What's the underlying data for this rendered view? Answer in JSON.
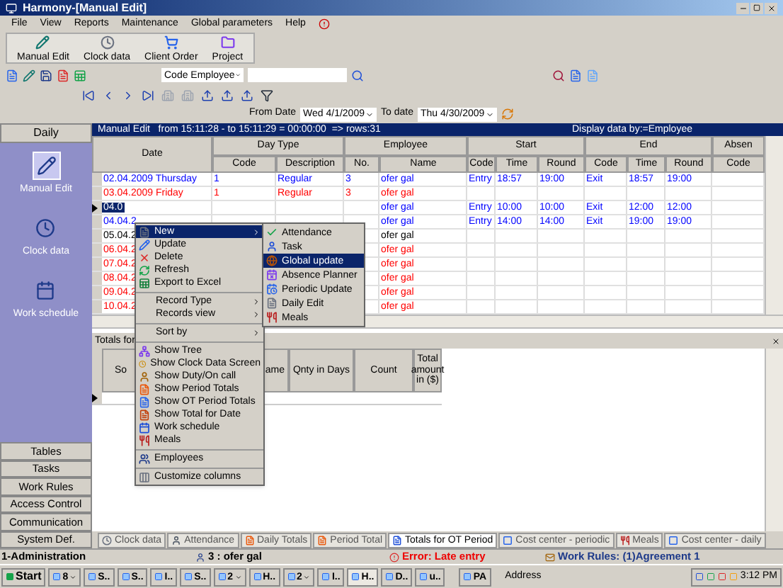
{
  "window": {
    "title": "Harmony-[Manual Edit]"
  },
  "menu": [
    "File",
    "View",
    "Reports",
    "Maintenance",
    "Global parameters",
    "Help"
  ],
  "toolbar": [
    "Manual Edit",
    "Clock data",
    "Client Order",
    "Project"
  ],
  "employee_selector": {
    "value": "Code Employee"
  },
  "date_range": {
    "from_label": "From Date",
    "from_value": "Wed 4/1/2009",
    "to_label": "To date",
    "to_value": "Thu 4/30/2009"
  },
  "sidebar": {
    "header": "Daily",
    "items": [
      {
        "label": "Manual Edit",
        "selected": true
      },
      {
        "label": "Clock data",
        "selected": false
      },
      {
        "label": "Work schedule",
        "selected": false
      }
    ],
    "sections": [
      "Tables",
      "Tasks",
      "Work Rules",
      "Access Control",
      "Communication",
      "System Def."
    ]
  },
  "grid": {
    "info": "Manual Edit   from 15:11:28 - to 15:11:29 = 00:00:00  => rows:31",
    "display_by": "Display data by:=Employee",
    "groups": [
      "Date",
      "Day Type",
      "Employee",
      "Start",
      "End",
      "Absen"
    ],
    "columns": [
      "Code",
      "Description",
      "No.",
      "Name",
      "Code",
      "Time",
      "Round",
      "Code",
      "Time",
      "Round",
      "Code"
    ],
    "rows": [
      {
        "date": "02.04.2009 Thursday",
        "color": "#0000ff",
        "selected": false,
        "code": "1",
        "description": "Regular",
        "no": "3",
        "name": "ofer gal",
        "start_code": "Entry",
        "start_time": "18:57",
        "start_round": "19:00",
        "end_code": "Exit",
        "end_time": "18:57",
        "end_round": "19:00"
      },
      {
        "date": "03.04.2009 Friday",
        "color": "#ff0000",
        "selected": false,
        "code": "1",
        "description": "Regular",
        "no": "3",
        "name": "ofer gal"
      },
      {
        "date": "04.0",
        "color": "#0000ff",
        "selected": true,
        "name": "ofer gal",
        "start_code": "Entry",
        "start_time": "10:00",
        "start_round": "10:00",
        "end_code": "Exit",
        "end_time": "12:00",
        "end_round": "12:00"
      },
      {
        "date": "04.04.2",
        "color": "#0000ff",
        "selected": false,
        "name": "ofer gal",
        "start_code": "Entry",
        "start_time": "14:00",
        "start_round": "14:00",
        "end_code": "Exit",
        "end_time": "19:00",
        "end_round": "19:00"
      },
      {
        "date": "05.04.2",
        "color": "#000000",
        "selected": false,
        "name": "ofer gal"
      },
      {
        "date": "06.04.2",
        "color": "#ff0000",
        "selected": false,
        "name": "ofer gal"
      },
      {
        "date": "07.04.2",
        "color": "#ff0000",
        "selected": false,
        "name": "ofer gal"
      },
      {
        "date": "08.04.2",
        "color": "#ff0000",
        "selected": false,
        "name": "ofer gal"
      },
      {
        "date": "09.04.2",
        "color": "#ff0000",
        "selected": false,
        "name": "ofer gal"
      },
      {
        "date": "10.04.2",
        "color": "#ff0000",
        "selected": false,
        "name": "ofer gal"
      }
    ]
  },
  "totals": {
    "title": "Totals for",
    "columns": [
      "So",
      "ame",
      "Qnty in Days",
      "Count",
      "Total amount in ($)"
    ]
  },
  "context_menu": {
    "items": [
      {
        "kind": "item",
        "label": "New",
        "submenu": true,
        "selected": true
      },
      {
        "kind": "item",
        "label": "Update",
        "submenu": false,
        "selected": false
      },
      {
        "kind": "item",
        "label": "Delete",
        "submenu": false,
        "selected": false
      },
      {
        "kind": "item",
        "label": "Refresh",
        "submenu": false,
        "selected": false
      },
      {
        "kind": "item",
        "label": "Export to Excel",
        "submenu": false,
        "selected": false
      },
      {
        "kind": "separator"
      },
      {
        "kind": "item",
        "label": "Record Type",
        "submenu": true,
        "selected": false
      },
      {
        "kind": "item",
        "label": "Records view",
        "submenu": true,
        "selected": false
      },
      {
        "kind": "separator"
      },
      {
        "kind": "item",
        "label": "Sort by",
        "submenu": true,
        "selected": false
      },
      {
        "kind": "separator"
      },
      {
        "kind": "item",
        "label": "Show Tree",
        "submenu": false,
        "selected": false
      },
      {
        "kind": "item",
        "label": "Show Clock Data Screen",
        "submenu": false,
        "selected": false
      },
      {
        "kind": "item",
        "label": "Show Duty/On call",
        "submenu": false,
        "selected": false
      },
      {
        "kind": "item",
        "label": "Show Period Totals",
        "submenu": false,
        "selected": false
      },
      {
        "kind": "item",
        "label": "Show OT Period Totals",
        "submenu": false,
        "selected": false
      },
      {
        "kind": "item",
        "label": "Show Total for Date",
        "submenu": false,
        "selected": false
      },
      {
        "kind": "item",
        "label": "Work schedule",
        "submenu": false,
        "selected": false
      },
      {
        "kind": "item",
        "label": "Meals",
        "submenu": false,
        "selected": false
      },
      {
        "kind": "separator"
      },
      {
        "kind": "item",
        "label": "Employees",
        "submenu": false,
        "selected": false
      },
      {
        "kind": "separator"
      },
      {
        "kind": "item",
        "label": "Customize columns",
        "submenu": false,
        "selected": false
      }
    ]
  },
  "submenu": {
    "items": [
      {
        "label": "Attendance",
        "selected": false
      },
      {
        "label": "Task",
        "selected": false
      },
      {
        "label": "Global update",
        "selected": true
      },
      {
        "label": "Absence Planner",
        "selected": false
      },
      {
        "label": "Periodic Update",
        "selected": false
      },
      {
        "label": "Daily Edit",
        "selected": false
      },
      {
        "label": "Meals",
        "selected": false
      }
    ]
  },
  "tabs": [
    {
      "label": "Clock data",
      "selected": false
    },
    {
      "label": "Attendance",
      "selected": false
    },
    {
      "label": "Daily Totals",
      "selected": false
    },
    {
      "label": "Period Total",
      "selected": false
    },
    {
      "label": "Totals for OT Period",
      "selected": true
    },
    {
      "label": "Cost center - periodic",
      "selected": false
    },
    {
      "label": "Meals",
      "selected": false
    },
    {
      "label": "Cost center - daily",
      "selected": false
    }
  ],
  "status_bar": {
    "user": "1-Administration",
    "employee": "3 : ofer gal",
    "error": "Error: Late entry",
    "work_rules": "Work Rules: (1)Agreement 1"
  },
  "taskbar": {
    "start": "Start",
    "buttons": [
      "8",
      "S..",
      "S..",
      "I..",
      "S..",
      "2",
      "H..",
      "2",
      "I..",
      "H..",
      "D..",
      "u..",
      "PA"
    ],
    "address": "Address",
    "clock": "3:12 PM"
  }
}
